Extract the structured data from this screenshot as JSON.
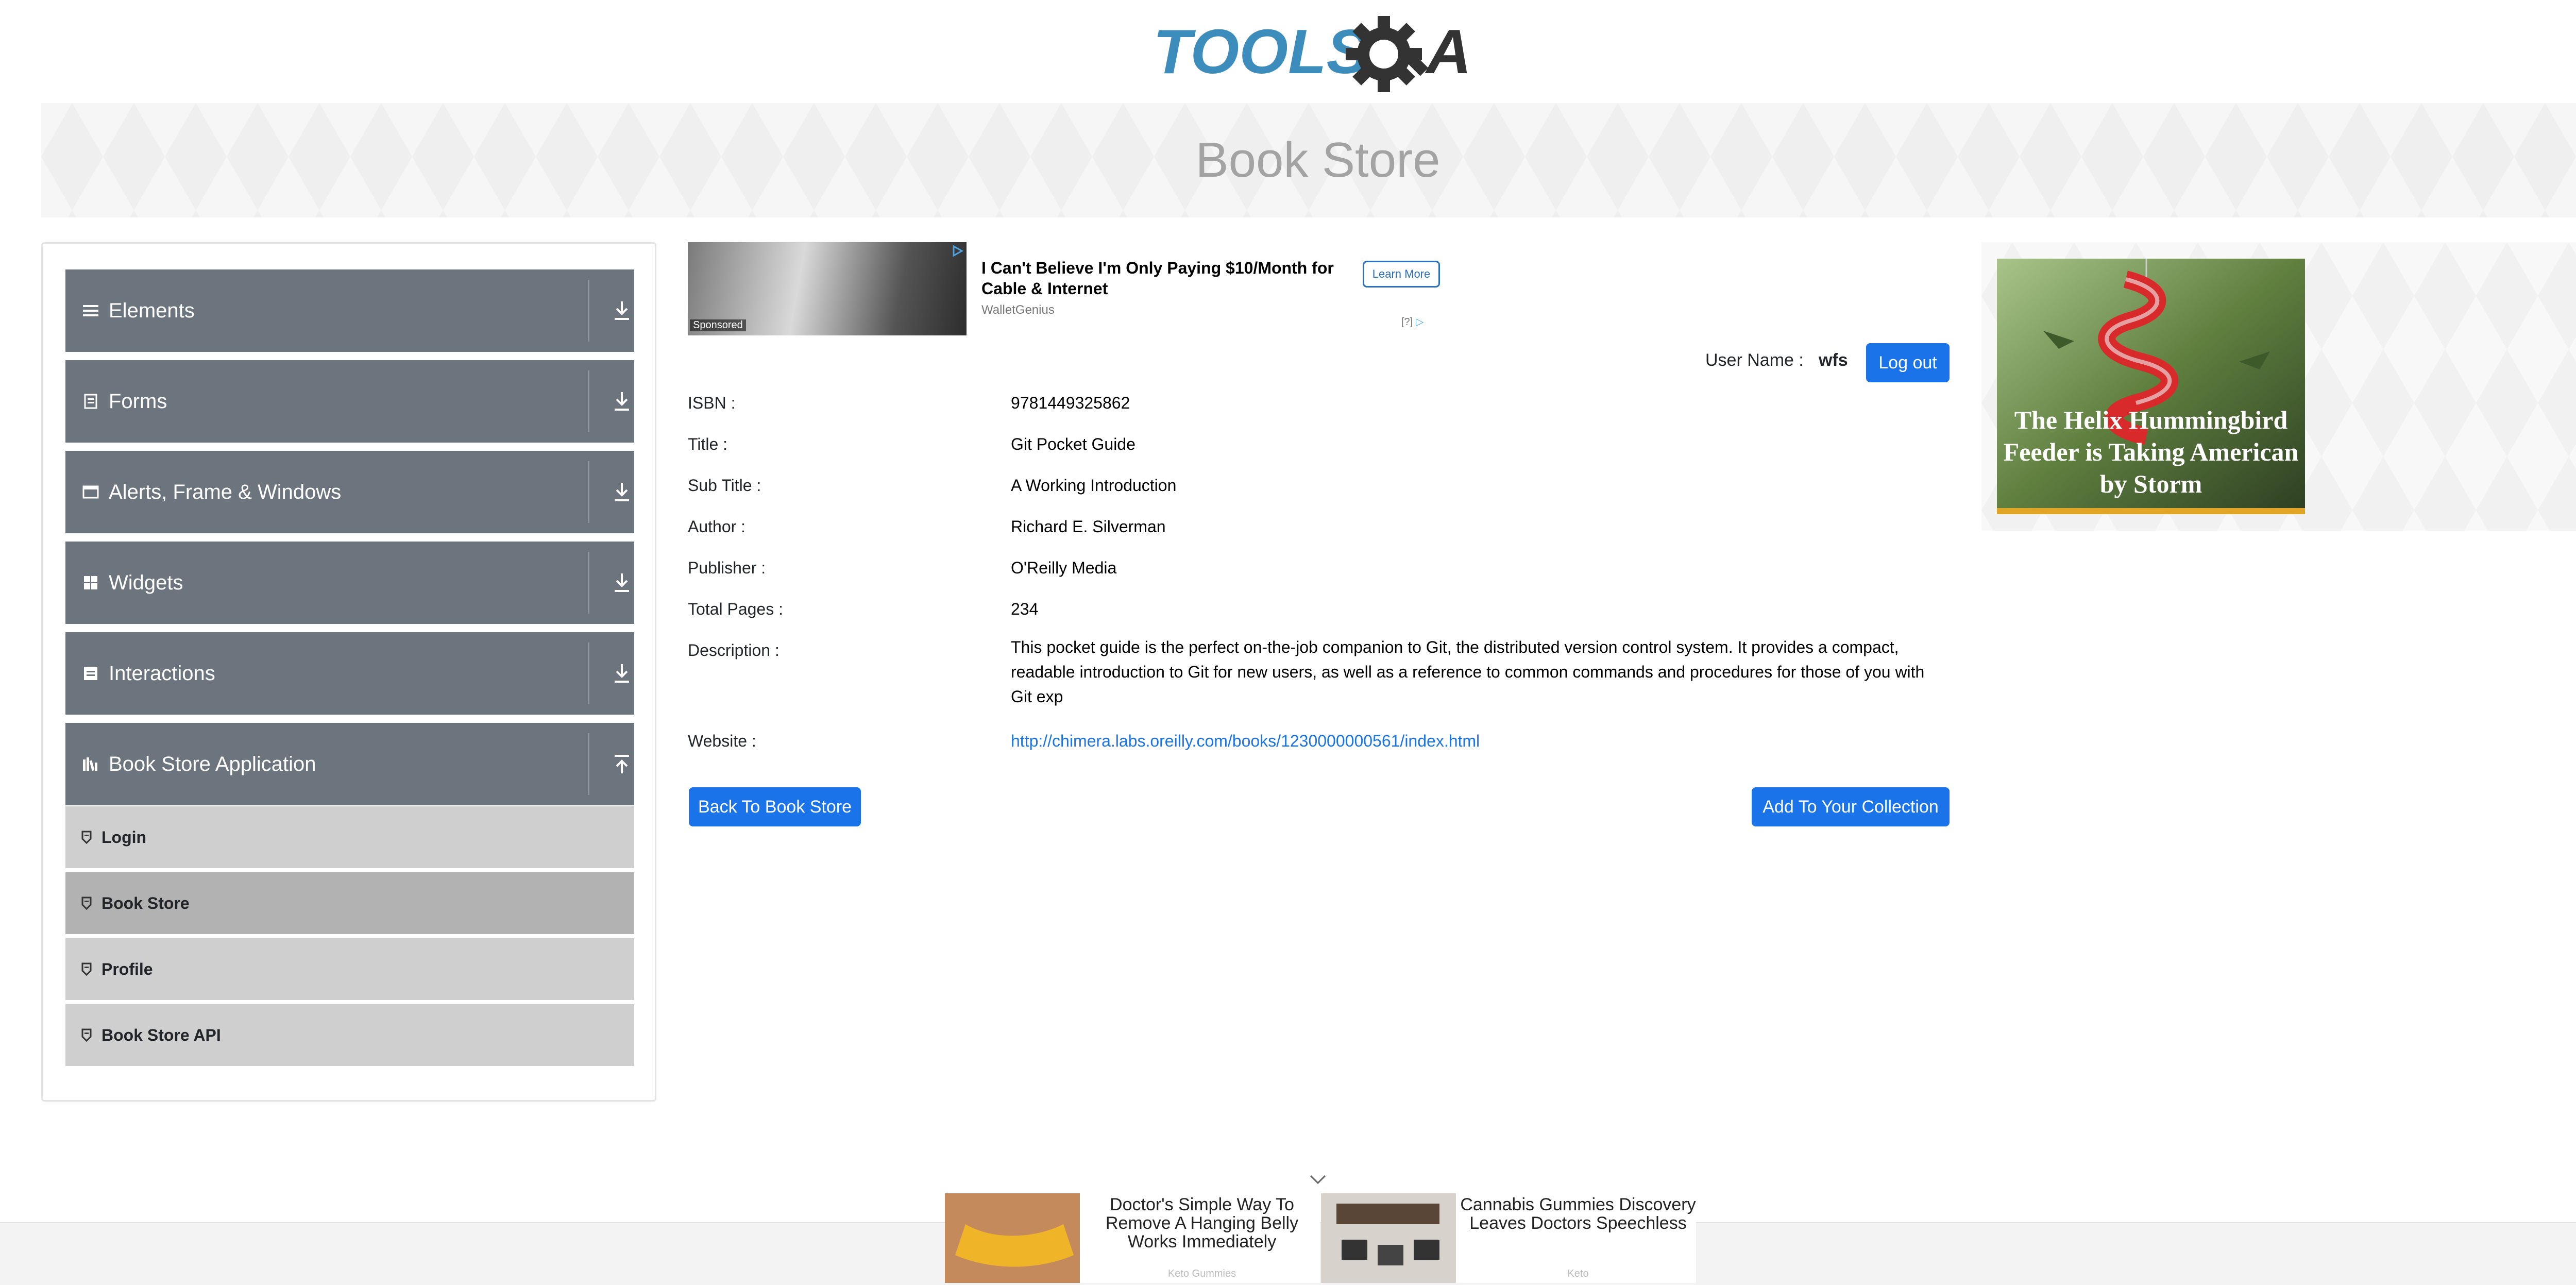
{
  "logo": {
    "text_main": "TOOLS",
    "text_q": "Q",
    "text_a": "A"
  },
  "header": {
    "title": "Book Store"
  },
  "sidebar": {
    "groups": [
      {
        "label": "Elements",
        "icon": "hamburger-icon"
      },
      {
        "label": "Forms",
        "icon": "form-icon"
      },
      {
        "label": "Alerts, Frame & Windows",
        "icon": "window-icon"
      },
      {
        "label": "Widgets",
        "icon": "grid-icon"
      },
      {
        "label": "Interactions",
        "icon": "interactions-icon"
      },
      {
        "label": "Book Store Application",
        "icon": "library-icon"
      }
    ],
    "items": [
      {
        "label": "Login"
      },
      {
        "label": "Book Store"
      },
      {
        "label": "Profile"
      },
      {
        "label": "Book Store API"
      }
    ]
  },
  "ad_top": {
    "sponsored": "Sponsored",
    "headline": "I Can't Believe I'm Only Paying $10/Month for Cable & Internet",
    "source": "WalletGenius",
    "button": "Learn More",
    "choice": "[?]"
  },
  "user": {
    "label": "User Name :",
    "value": "wfs",
    "logout": "Log out"
  },
  "book": {
    "isbn": {
      "label": "ISBN :",
      "value": "9781449325862"
    },
    "title": {
      "label": "Title :",
      "value": "Git Pocket Guide"
    },
    "subtitle": {
      "label": "Sub Title :",
      "value": "A Working Introduction"
    },
    "author": {
      "label": "Author :",
      "value": "Richard E. Silverman"
    },
    "publisher": {
      "label": "Publisher :",
      "value": "O'Reilly Media"
    },
    "pages": {
      "label": "Total Pages :",
      "value": "234"
    },
    "description": {
      "label": "Description :",
      "value": "This pocket guide is the perfect on-the-job companion to Git, the distributed version control system. It provides a compact, readable introduction to Git for new users, as well as a reference to common commands and procedures for those of you with Git exp"
    },
    "website": {
      "label": "Website :",
      "value": "http://chimera.labs.oreilly.com/books/1230000000561/index.html"
    }
  },
  "actions": {
    "back": "Back To Book Store",
    "add": "Add To Your Collection"
  },
  "ad_right": {
    "caption": "The Helix Hummingbird Feeder is Taking American by Storm"
  },
  "footer_ads": [
    {
      "text": "Doctor's Simple Way To Remove A Hanging Belly Works Immediately",
      "source": "Keto Gummies"
    },
    {
      "text": "Cannabis Gummies Discovery Leaves Doctors Speechless",
      "source": "Keto"
    }
  ],
  "colors": {
    "accent": "#1a73e8",
    "sidebar_header": "#6c757d",
    "sub_item": "#cfcfcf",
    "sub_item_active": "#b2b2b2",
    "logo_blue": "#3c8dbc",
    "logo_dark": "#333333"
  }
}
